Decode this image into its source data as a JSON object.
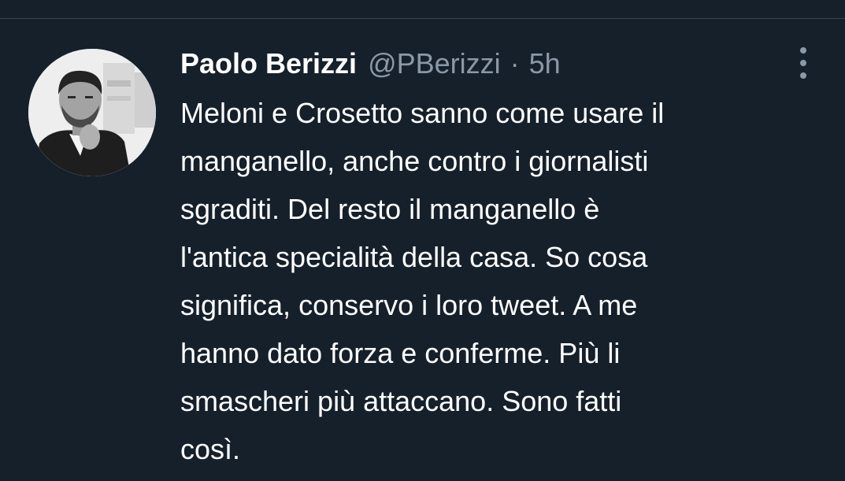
{
  "tweet": {
    "author_name": "Paolo Berizzi",
    "author_handle": "@PBerizzi",
    "separator": "·",
    "time": "5h",
    "text_lines": [
      "Meloni e Crosetto sanno come usare il",
      "manganello, anche contro i giornalisti",
      "sgraditi. Del resto il manganello è",
      "l'antica specialità della casa. So cosa",
      "significa, conservo i loro tweet. A me",
      "hanno dato forza e conferme. Più li",
      "smascheri più attaccano. Sono fatti",
      "così."
    ]
  },
  "icons": {
    "more": "more-vertical-icon",
    "avatar": "profile-photo"
  },
  "colors": {
    "background": "#15202b",
    "primary_text": "#ffffff",
    "secondary_text": "#8b98a5",
    "divider": "#38444d"
  }
}
